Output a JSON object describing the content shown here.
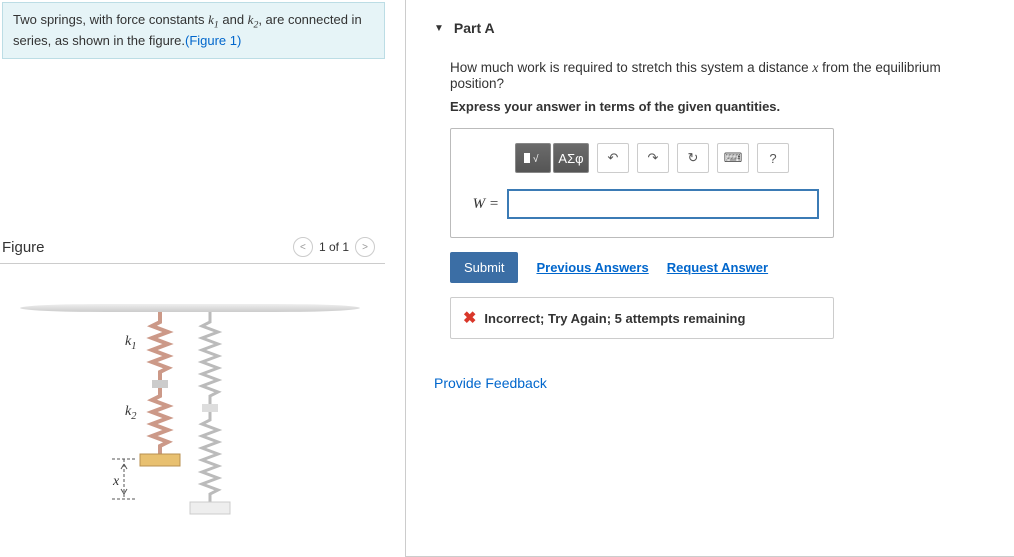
{
  "problem": {
    "text_prefix": "Two springs, with force constants ",
    "k1": "k",
    "sub1": "1",
    "and": " and ",
    "k2": "k",
    "sub2": "2",
    "text_mid": ", are connected in series, as shown in the figure.",
    "figure_link": "(Figure 1)"
  },
  "figure": {
    "title": "Figure",
    "counter": "1 of 1",
    "k1_label": "k",
    "k1_sub": "1",
    "k2_label": "k",
    "k2_sub": "2",
    "x_label": "x"
  },
  "part": {
    "header": "Part A",
    "question_prefix": "How much work is required to stretch this system a distance ",
    "question_var": "x",
    "question_suffix": " from the equilibrium position?",
    "instruction": "Express your answer in terms of the given quantities.",
    "answer_label": "W =",
    "toolbar": {
      "templates": "⬛√x",
      "greek": "ΑΣφ",
      "undo": "↶",
      "redo": "↷",
      "reset": "↻",
      "keyboard": "⌨",
      "help": "?"
    },
    "submit": "Submit",
    "previous_answers": "Previous Answers",
    "request_answer": "Request Answer",
    "feedback": "Incorrect; Try Again; 5 attempts remaining"
  },
  "provide_feedback": "Provide Feedback"
}
